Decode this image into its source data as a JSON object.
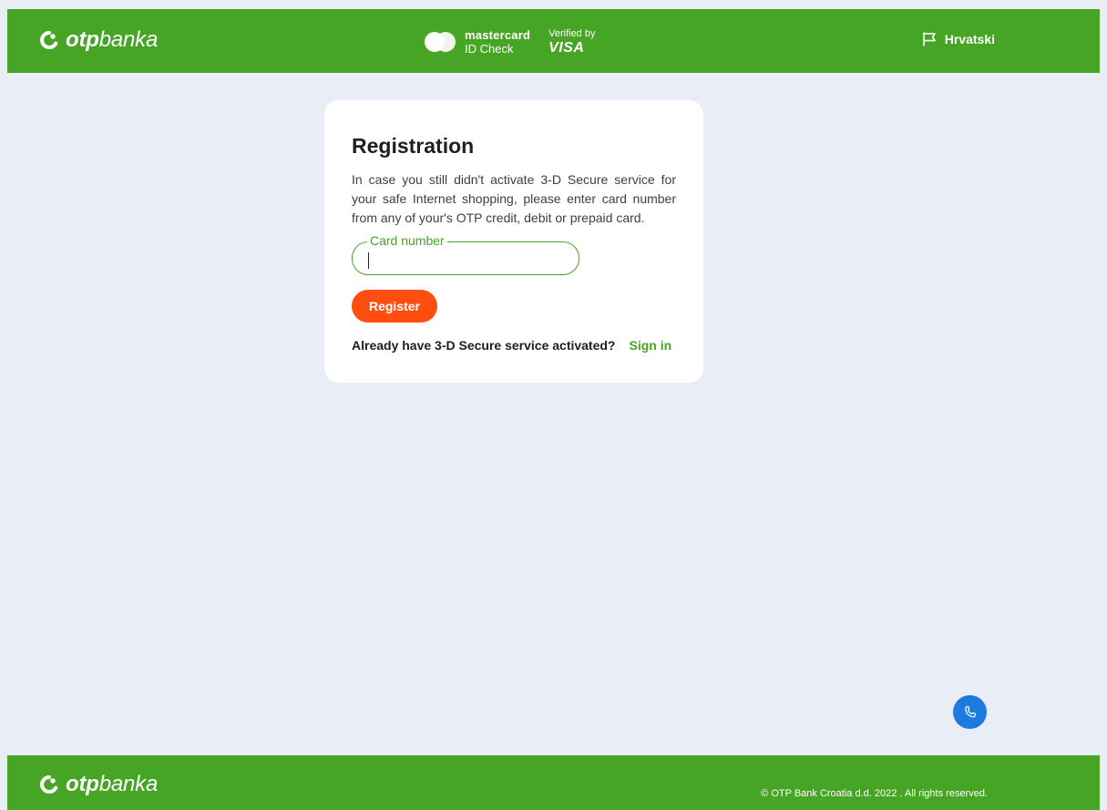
{
  "header": {
    "logo": {
      "otp": "otp",
      "banka": "banka"
    },
    "brands": {
      "mastercard": {
        "line1": "mastercard",
        "line2": "ID Check"
      },
      "visa": {
        "line1": "Verified by",
        "line2": "VISA"
      }
    },
    "language": "Hrvatski"
  },
  "registration": {
    "title": "Registration",
    "description": "In case you still didn't activate 3-D Secure service for your safe Internet shopping, please enter card number from any of your's OTP credit, debit or prepaid card.",
    "card_number_label": "Card number",
    "card_number_value": "",
    "register_label": "Register",
    "already_text": "Already have 3-D Secure service activated?",
    "sign_in_label": "Sign in"
  },
  "footer": {
    "logo": {
      "otp": "otp",
      "banka": "banka"
    },
    "copyright": "© OTP Bank Croatia d.d. 2022 . All rights reserved."
  },
  "icons": {
    "brand": "otp-logo-icon",
    "language": "flag-icon",
    "call": "phone-icon"
  },
  "colors": {
    "brand_green": "#47a526",
    "page_background": "#e9edf6",
    "register_orange": "#ff4e0f",
    "call_blue": "#1f7ae0"
  }
}
